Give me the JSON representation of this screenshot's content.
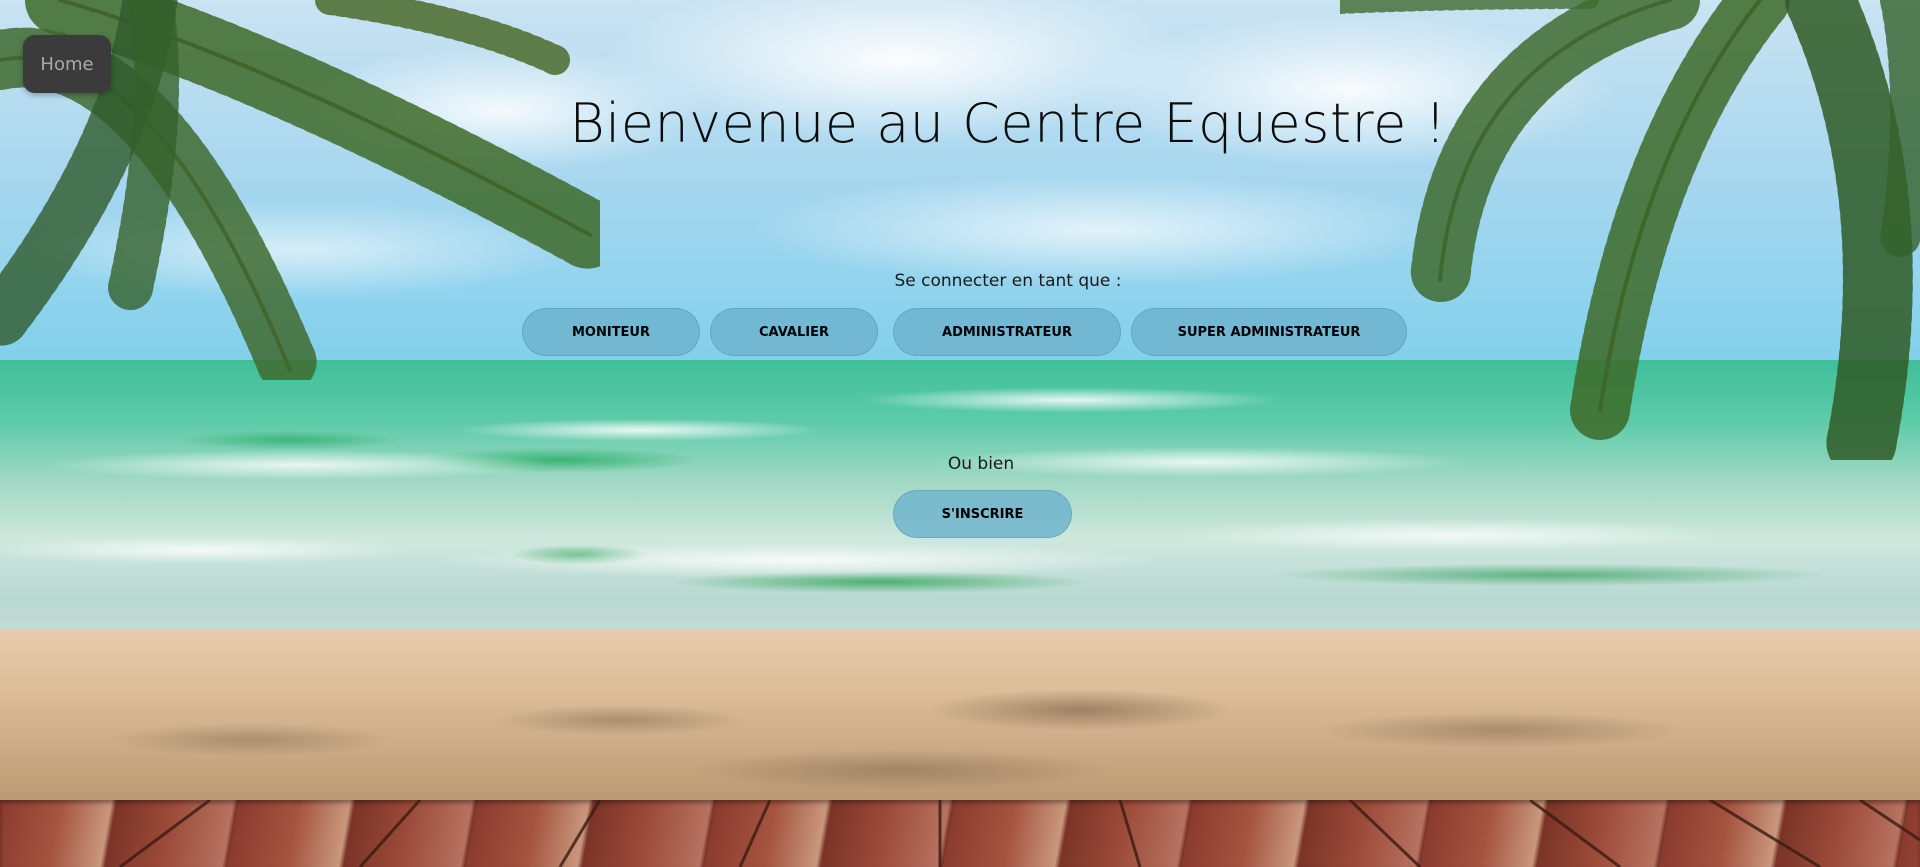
{
  "nav": {
    "home_label": "Home"
  },
  "hero": {
    "title": "Bienvenue au Centre Equestre !"
  },
  "login": {
    "prompt": "Se connecter en tant que :",
    "roles": [
      {
        "label": "MONITEUR"
      },
      {
        "label": "CAVALIER"
      },
      {
        "label": "ADMINISTRATEUR"
      },
      {
        "label": "SUPER ADMINISTRATEUR"
      }
    ]
  },
  "register": {
    "or_text": "Ou bien",
    "button_label": "S'INSCRIRE"
  },
  "colors": {
    "button_bg": "#6eb2cd",
    "home_button_bg": "#3b3b3b",
    "title_color": "#0c0c0c"
  },
  "background": {
    "icons": [
      "palm-leaves-left",
      "palm-leaves-right"
    ]
  }
}
